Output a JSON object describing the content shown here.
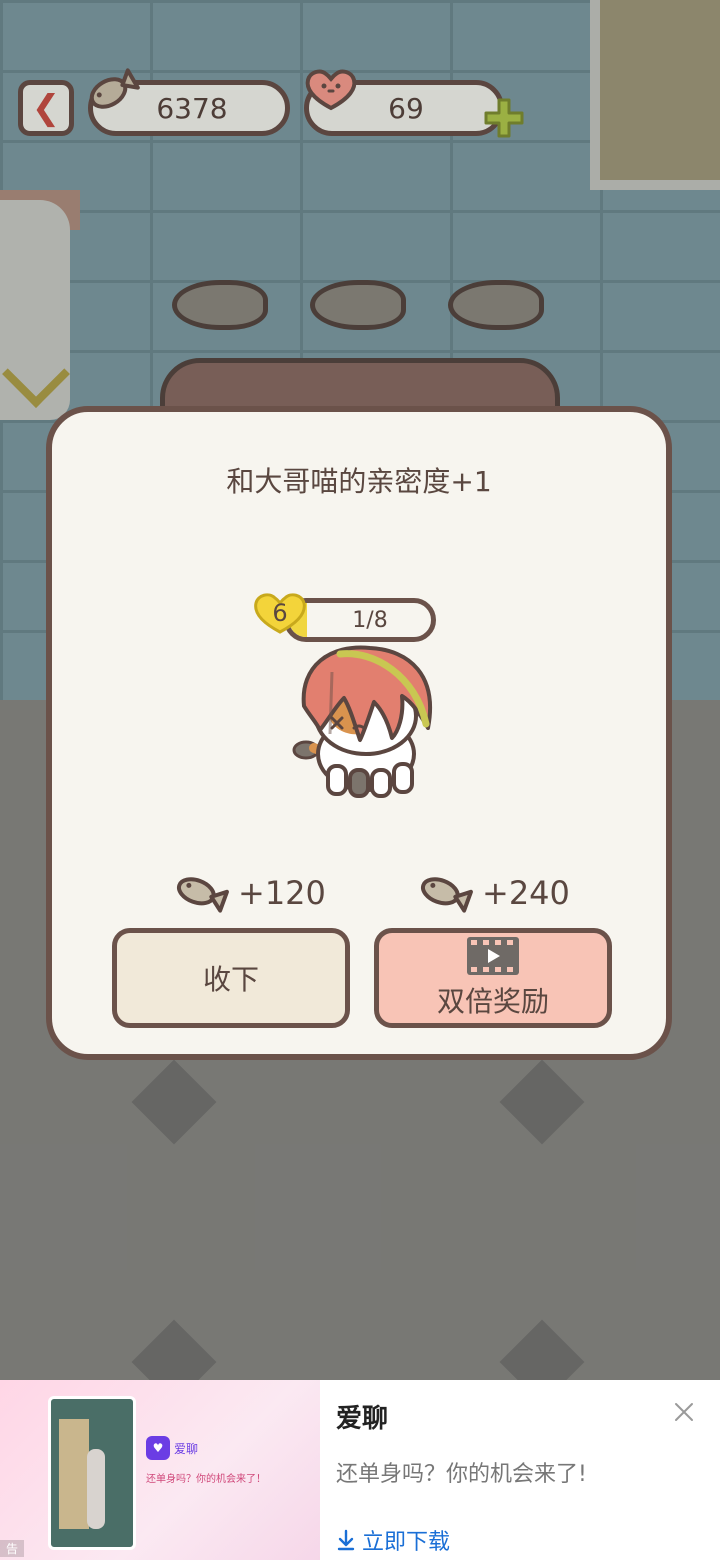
{
  "top_bar": {
    "fish_count": "6378",
    "heart_count": "69"
  },
  "dialog": {
    "title": "和大哥喵的亲密度+1",
    "level": "6",
    "progress_text": "1/8",
    "progress_fraction": 0.125,
    "reward_normal": "+120",
    "reward_double": "+240",
    "accept_label": "收下",
    "double_label": "双倍奖励"
  },
  "ad": {
    "app_name": "爱聊",
    "description": "还单身吗？你的机会来了!",
    "cta_label": "立即下载",
    "mini_app_name": "爱聊",
    "mini_text": "还单身吗？你的机会来了！",
    "mini_footer": "告"
  },
  "colors": {
    "accent_red": "#b0453c",
    "outline_brown": "#6b524a",
    "double_button": "#f8c4b6",
    "link_blue": "#1a6fd6"
  },
  "icons": {
    "back": "chevron-left-icon",
    "fish": "fish-icon",
    "heart": "heart-icon",
    "plus": "plus-icon",
    "video": "video-play-icon",
    "close": "close-icon",
    "download": "download-arrow-icon"
  }
}
